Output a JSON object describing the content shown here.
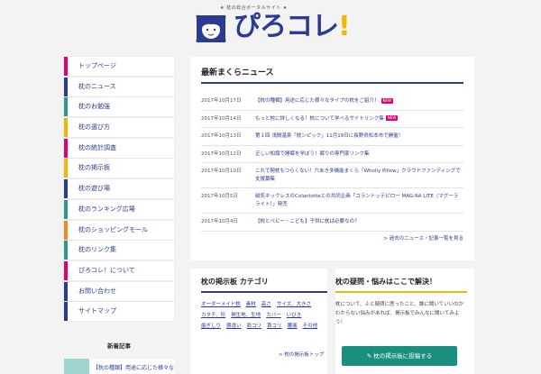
{
  "header": {
    "tagline": "★ 枕の総合ポータルサイト ★",
    "logo_text": "ぴろコレ",
    "logo_bang": "!"
  },
  "sidebar": {
    "items": [
      {
        "label": "トップページ",
        "color": "#e4006e"
      },
      {
        "label": "枕のニュース",
        "color": "#2b3a93"
      },
      {
        "label": "枕のお勉強",
        "color": "#2b9a8a"
      },
      {
        "label": "枕の選び方",
        "color": "#f2b705"
      },
      {
        "label": "枕の統計調査",
        "color": "#e4006e"
      },
      {
        "label": "枕の掲示板",
        "color": "#f2b705"
      },
      {
        "label": "枕の遊び場",
        "color": "#2b3a93"
      },
      {
        "label": "枕のランキング広場",
        "color": "#2b9a8a"
      },
      {
        "label": "枕のショッピングモール",
        "color": "#f08a24"
      },
      {
        "label": "枕のリンク集",
        "color": "#2b9a8a"
      },
      {
        "label": "ぴろコレ！について",
        "color": "#e4006e"
      },
      {
        "label": "お問い合わせ",
        "color": "#2b3a93"
      },
      {
        "label": "サイトマップ",
        "color": "#2b3a93"
      }
    ],
    "news_title": "新着記事",
    "news_item": "【枕の種類】用途に応じた様々な"
  },
  "main": {
    "title": "最新まくらニュース",
    "news": [
      {
        "date": "2017年10月17日",
        "title": "【枕の種類】用途に応じた様々なタイプの枕をご紹介！",
        "badge": "NEW"
      },
      {
        "date": "2017年10月14日",
        "title": "もっと枕に詳しくなる！枕について学べるサイトリンク集",
        "badge": "NEW"
      },
      {
        "date": "2017年10月13日",
        "title": "第１回 浅間温泉「枕ンピック」11月19日に長野県松本市で開催！",
        "badge": ""
      },
      {
        "date": "2017年10月12日",
        "title": "正しい知識で睡眠を学ぼう！眠りの専門家リンク集",
        "badge": ""
      },
      {
        "date": "2017年10月10日",
        "title": "これで腕枕もつらくない！穴あき多機能まくら「Wholly Pillow」クラウドファンディングで支援募集",
        "badge": ""
      },
      {
        "date": "2017年10月5日",
        "title": "磁気ネックレスのColantotteとの共同企画「コラントッテピロー MAG-RA LITE（マグーラ ライト）」発売",
        "badge": ""
      },
      {
        "date": "2017年10月4日",
        "title": "【枕とベビー・こども】子供に枕は必要なの？",
        "badge": ""
      }
    ],
    "more_link": "> 過去のニュース・記事一覧を見る"
  },
  "board": {
    "title": "枕の掲示板 カテゴリ",
    "tags": [
      "オーダーメイド枕",
      "素材",
      "高さ",
      "サイズ、大きさ",
      "カタチ、形",
      "側生地、生地",
      "カバー",
      "いびき",
      "歯ぎしり",
      "寝違い",
      "肩コリ",
      "首コリ",
      "腰痛",
      "その他"
    ],
    "more": "> 枕の掲示板トップ"
  },
  "qa": {
    "title": "枕の疑問・悩みはここで解決！",
    "text": "枕について、ふと疑問に思ったこと、誰に聞いていいのかわからない悩みがあれば、掲示板でみんなに聞いてみよう！",
    "button": "✎ 枕の掲示板に投稿する"
  }
}
